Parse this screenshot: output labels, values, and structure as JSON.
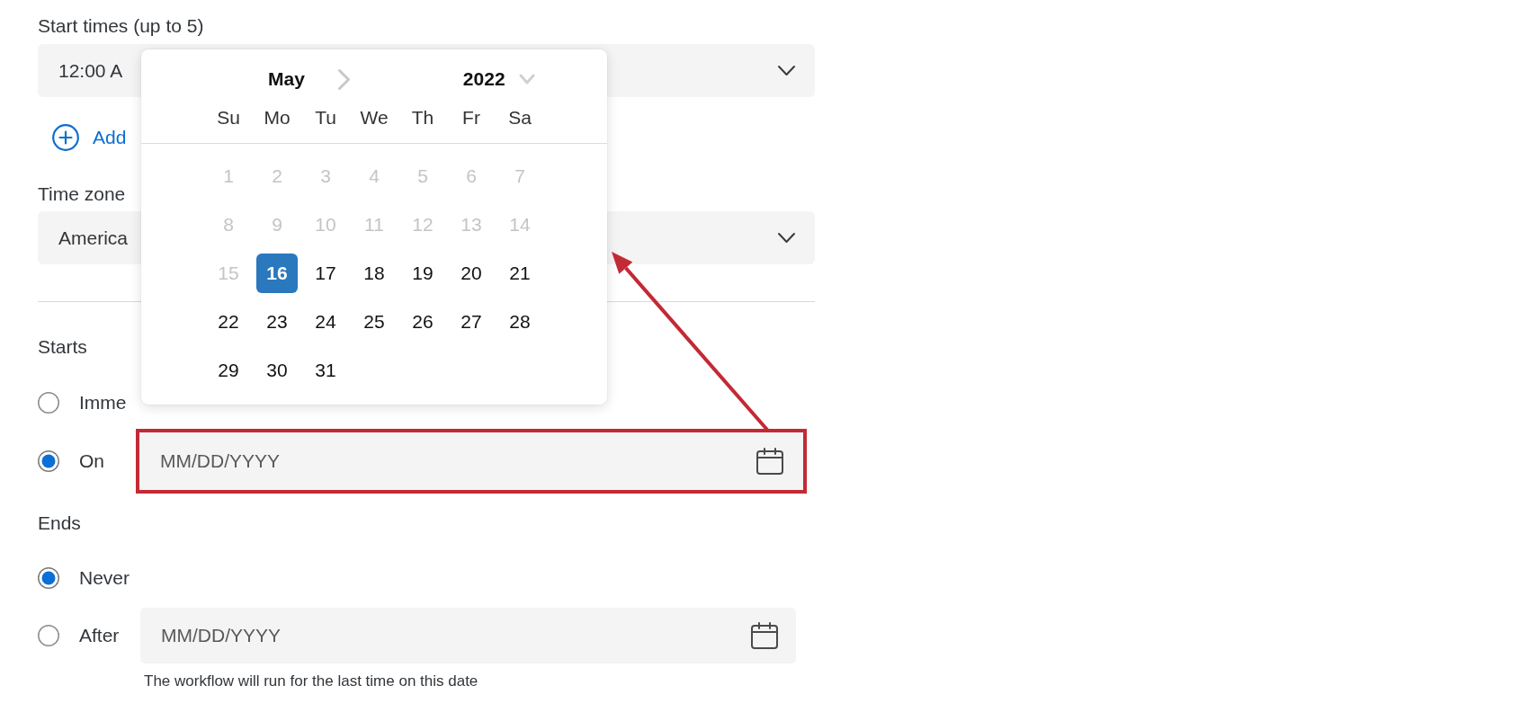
{
  "start_times": {
    "label": "Start times (up to 5)",
    "value": "12:00 A",
    "add_label": "Add"
  },
  "time_zone": {
    "label": "Time zone",
    "value": "America"
  },
  "starts": {
    "label": "Starts",
    "options": [
      {
        "kind": "plain",
        "label": "Imme",
        "selected": false
      },
      {
        "kind": "date",
        "label": "On",
        "placeholder": "MM/DD/YYYY",
        "highlighted": true,
        "selected": true
      }
    ]
  },
  "ends": {
    "label": "Ends",
    "options": [
      {
        "kind": "plain",
        "label": "Never",
        "selected": true
      },
      {
        "kind": "date",
        "label": "After",
        "placeholder": "MM/DD/YYYY",
        "hint": "The workflow will run for the last time on this date",
        "highlighted": false,
        "selected": false
      }
    ]
  },
  "date_picker": {
    "month": "May",
    "year": "2022",
    "weekdays": [
      "Su",
      "Mo",
      "Tu",
      "We",
      "Th",
      "Fr",
      "Sa"
    ],
    "days": [
      {
        "label": "1",
        "disabled": true,
        "selected": false
      },
      {
        "label": "2",
        "disabled": true,
        "selected": false
      },
      {
        "label": "3",
        "disabled": true,
        "selected": false
      },
      {
        "label": "4",
        "disabled": true,
        "selected": false
      },
      {
        "label": "5",
        "disabled": true,
        "selected": false
      },
      {
        "label": "6",
        "disabled": true,
        "selected": false
      },
      {
        "label": "7",
        "disabled": true,
        "selected": false
      },
      {
        "label": "8",
        "disabled": true,
        "selected": false
      },
      {
        "label": "9",
        "disabled": true,
        "selected": false
      },
      {
        "label": "10",
        "disabled": true,
        "selected": false
      },
      {
        "label": "11",
        "disabled": true,
        "selected": false
      },
      {
        "label": "12",
        "disabled": true,
        "selected": false
      },
      {
        "label": "13",
        "disabled": true,
        "selected": false
      },
      {
        "label": "14",
        "disabled": true,
        "selected": false
      },
      {
        "label": "15",
        "disabled": true,
        "selected": false
      },
      {
        "label": "16",
        "disabled": false,
        "selected": true
      },
      {
        "label": "17",
        "disabled": false,
        "selected": false
      },
      {
        "label": "18",
        "disabled": false,
        "selected": false
      },
      {
        "label": "19",
        "disabled": false,
        "selected": false
      },
      {
        "label": "20",
        "disabled": false,
        "selected": false
      },
      {
        "label": "21",
        "disabled": false,
        "selected": false
      },
      {
        "label": "22",
        "disabled": false,
        "selected": false
      },
      {
        "label": "23",
        "disabled": false,
        "selected": false
      },
      {
        "label": "24",
        "disabled": false,
        "selected": false
      },
      {
        "label": "25",
        "disabled": false,
        "selected": false
      },
      {
        "label": "26",
        "disabled": false,
        "selected": false
      },
      {
        "label": "27",
        "disabled": false,
        "selected": false
      },
      {
        "label": "28",
        "disabled": false,
        "selected": false
      },
      {
        "label": "29",
        "disabled": false,
        "selected": false
      },
      {
        "label": "30",
        "disabled": false,
        "selected": false
      },
      {
        "label": "31",
        "disabled": false,
        "selected": false
      }
    ]
  }
}
